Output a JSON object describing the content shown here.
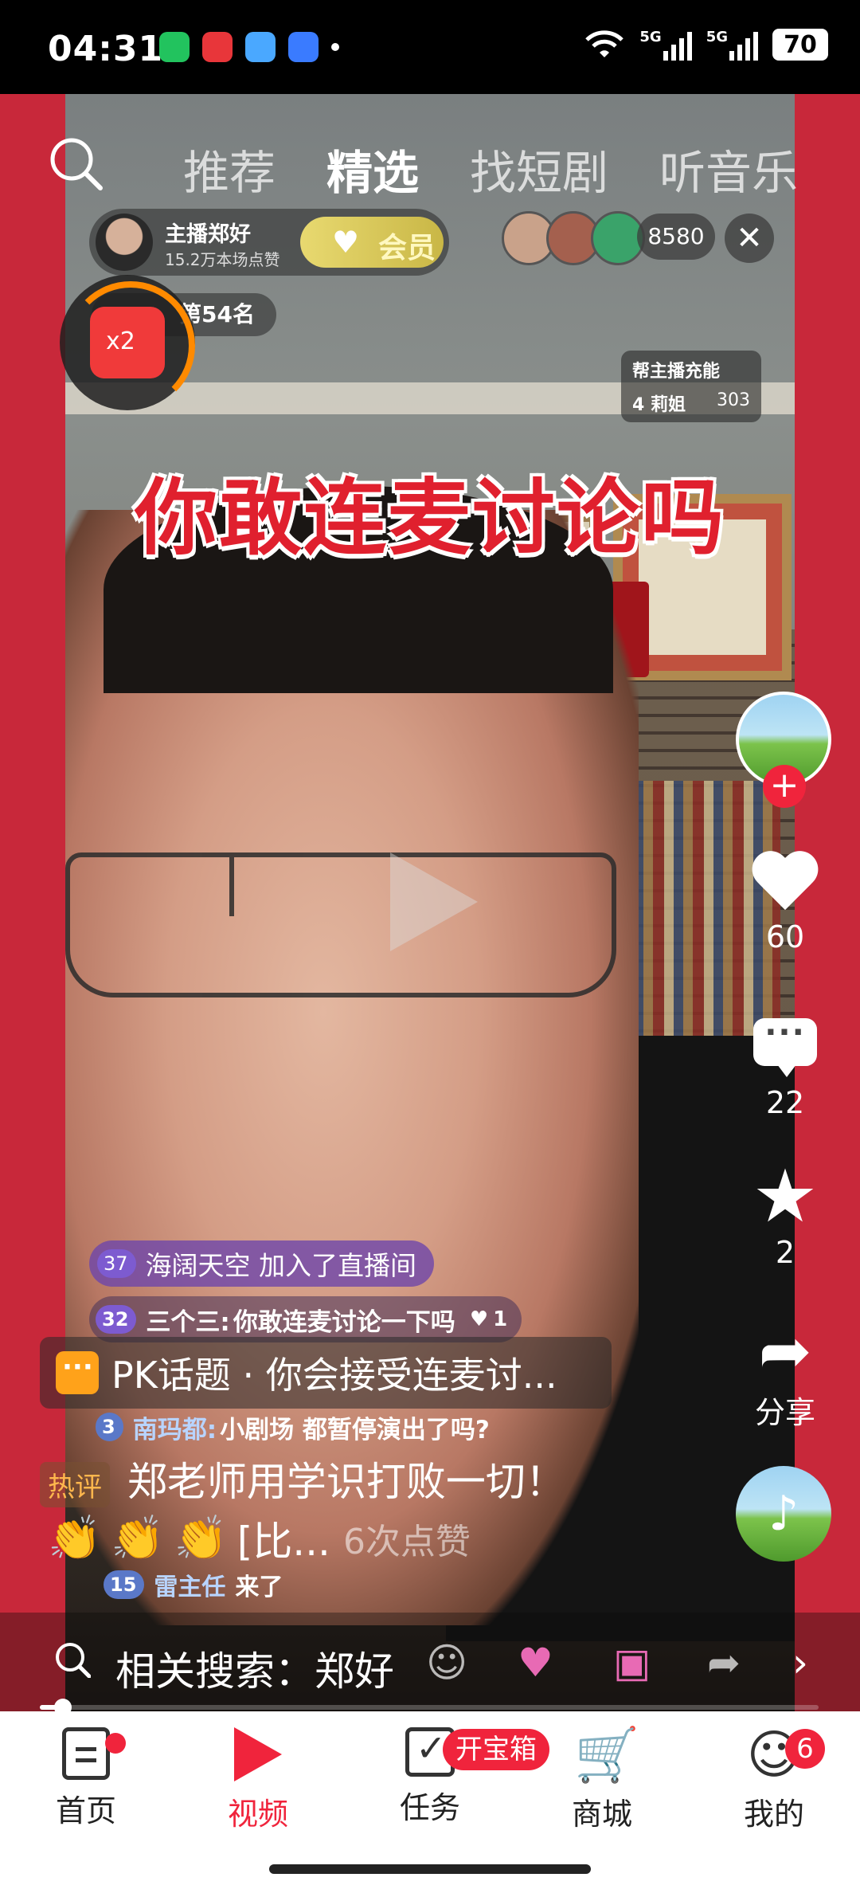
{
  "status_bar": {
    "time": "04:31",
    "network_1": "5G",
    "network_2": "5G",
    "battery": "70"
  },
  "top_tabs": [
    {
      "label": "推荐",
      "active": false
    },
    {
      "label": "精选",
      "active": true
    },
    {
      "label": "找短剧",
      "active": false
    },
    {
      "label": "听音乐",
      "active": false
    }
  ],
  "streamer": {
    "name": "主播郑好",
    "likes": "15.2万本场点赞",
    "member_label": "会员"
  },
  "viewer_count": "8580",
  "rank": "第54名",
  "red_packet": "x2",
  "energy": {
    "title": "帮主播充能",
    "rank_user": "4 莉姐",
    "score": "303"
  },
  "headline": "你敢连麦讨论吗",
  "actions": {
    "like_count": "60",
    "comment_count": "22",
    "favorite_count": "2",
    "share_label": "分享"
  },
  "chat": {
    "join": {
      "level": "37",
      "text": "海阔天空 加入了直播间"
    },
    "rows": [
      {
        "level": "32",
        "nick": "三个三:",
        "text": "你敢连麦讨论一下吗",
        "likes": "1"
      },
      {
        "level": "3",
        "nick": "南玛都:",
        "text": "小剧场 都暂停演出了吗?",
        "likes": ""
      }
    ],
    "last": {
      "level": "15",
      "nick": "雷主任",
      "text": "来了"
    }
  },
  "pk_topic": "PK话题 · 你会接受连麦讨...",
  "hot_comment": {
    "tag": "热评",
    "text": "郑老师用学识打败一切！"
  },
  "likes_line": {
    "prefix": "[比...",
    "text": "6次点赞"
  },
  "search": {
    "label": "相关搜索：",
    "keyword": "郑好"
  },
  "progress": 0.03,
  "bottom_nav": [
    {
      "label": "首页",
      "active": false
    },
    {
      "label": "视频",
      "active": true
    },
    {
      "label": "任务",
      "active": false
    },
    {
      "label": "商城",
      "active": false
    },
    {
      "label": "我的",
      "active": false
    }
  ],
  "treasure_label": "开宝箱",
  "me_badge": "6",
  "colors": {
    "accent": "#f0243c",
    "headline": "#e0202e",
    "side": "#c8283a"
  }
}
